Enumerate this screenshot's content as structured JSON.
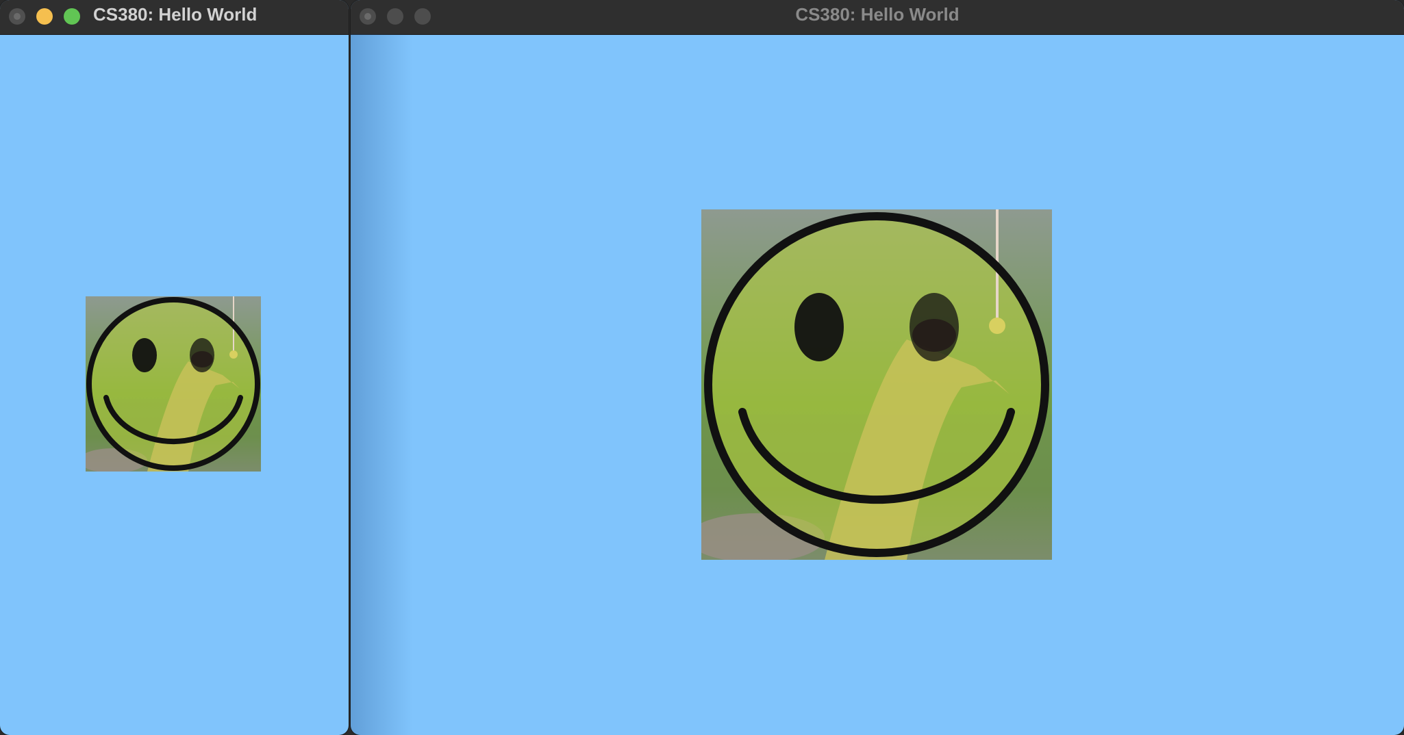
{
  "windows": [
    {
      "title": "CS380: Hello World",
      "focused": true
    },
    {
      "title": "CS380: Hello World",
      "focused": false
    }
  ],
  "colors": {
    "background": "#80c4fc",
    "titlebar": "#2f2f2f",
    "smiley_fill": "#b8d23a",
    "smiley_stroke": "#111111"
  }
}
